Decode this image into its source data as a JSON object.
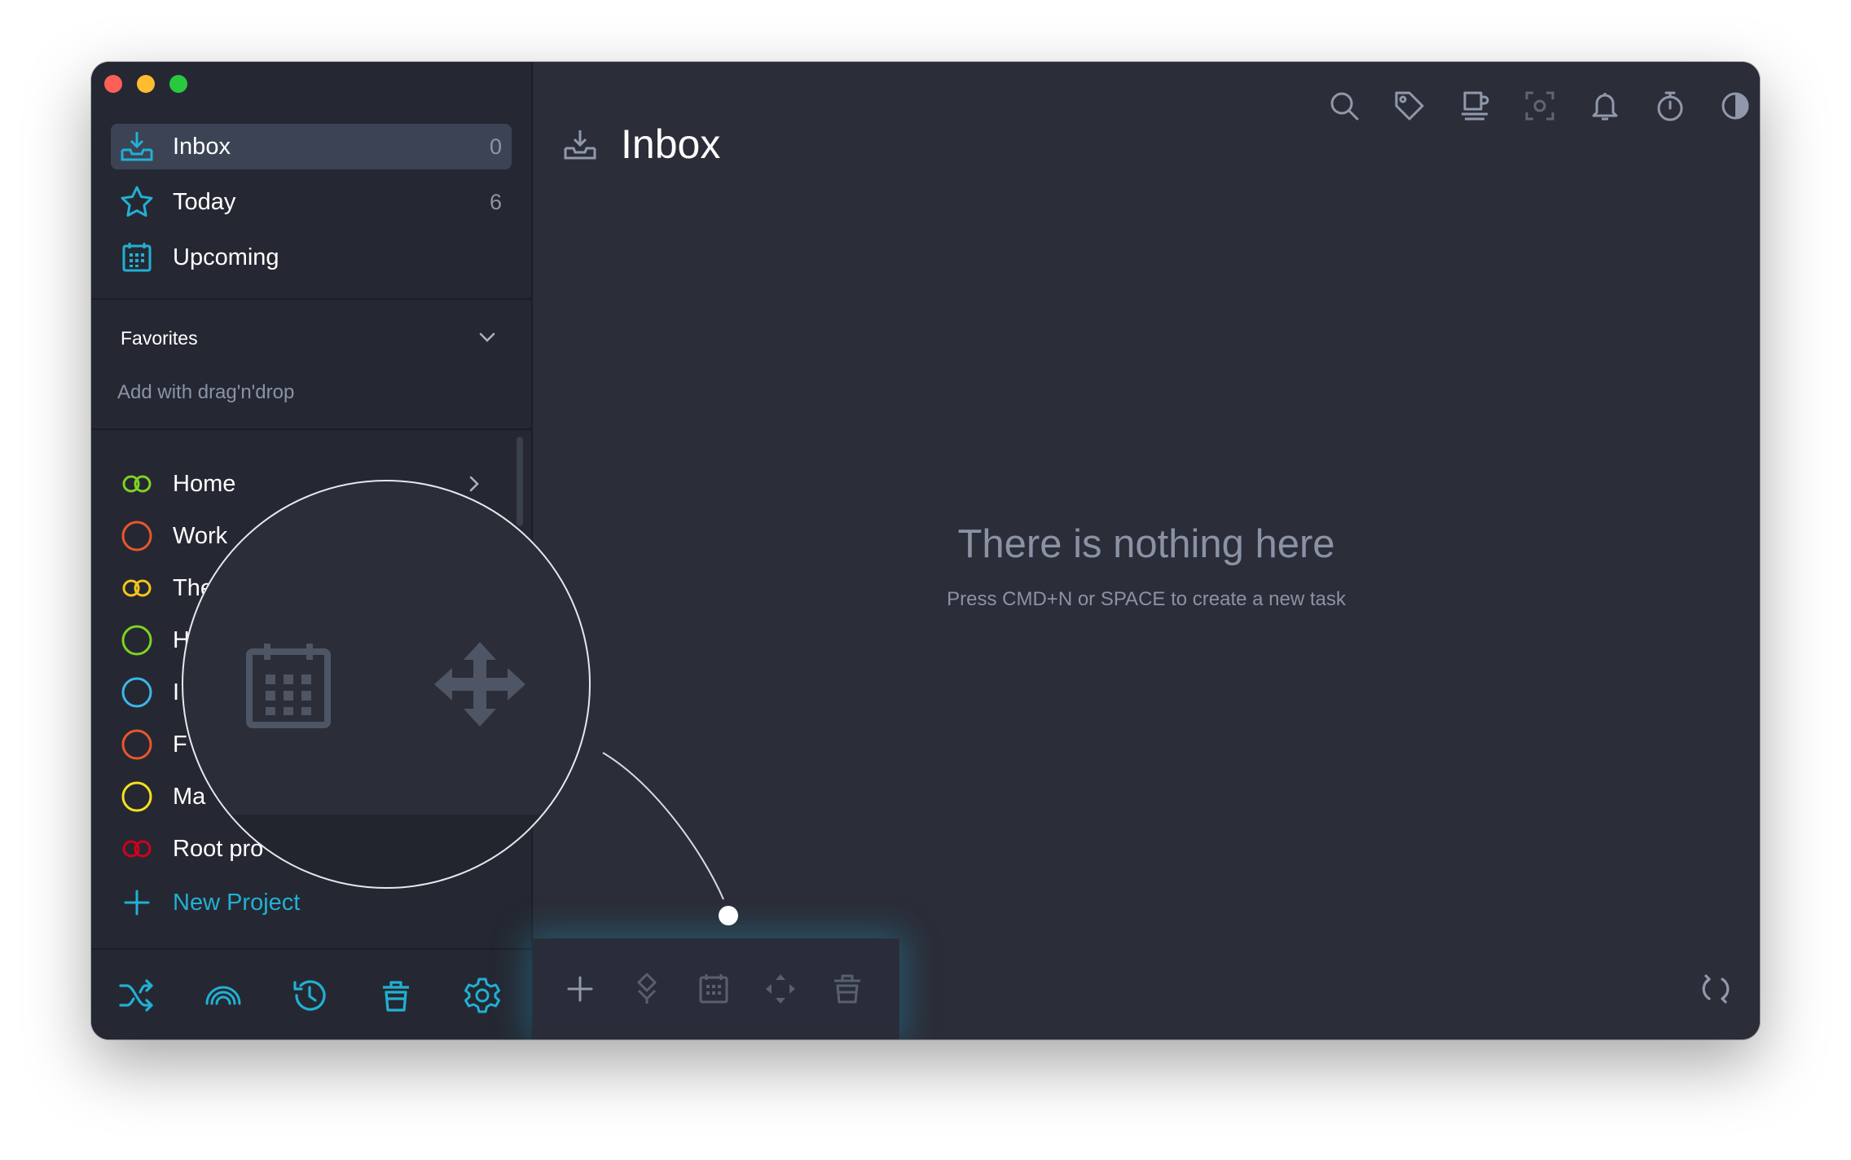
{
  "sidebar": {
    "nav": [
      {
        "label": "Inbox",
        "count": "0",
        "icon": "inbox-icon",
        "active": true
      },
      {
        "label": "Today",
        "count": "6",
        "icon": "star-icon",
        "active": false
      },
      {
        "label": "Upcoming",
        "count": "",
        "icon": "calendar-icon",
        "active": false
      }
    ],
    "favorites": {
      "title": "Favorites",
      "hint": "Add with drag'n'drop"
    },
    "projects": [
      {
        "label": "Home",
        "color": "#7ed321",
        "icon": "project-ring-icon"
      },
      {
        "label": "Work",
        "color": "#e8572c",
        "icon": "project-circle-icon"
      },
      {
        "label": "The",
        "color": "#f5c518",
        "icon": "project-ring-icon"
      },
      {
        "label": "H",
        "color": "#7ed321",
        "icon": "project-circle-icon"
      },
      {
        "label": "I",
        "color": "#3db7e8",
        "icon": "project-circle-icon"
      },
      {
        "label": "F",
        "color": "#e8572c",
        "icon": "project-circle-icon"
      },
      {
        "label": "Ma",
        "color": "#f5e11f",
        "icon": "project-circle-icon"
      },
      {
        "label": "Root pro",
        "color": "#d0021b",
        "icon": "project-ring-icon"
      }
    ],
    "new_project": "New Project",
    "bottom_icons": [
      "shuffle-icon",
      "rainbow-icon",
      "history-icon",
      "trash-icon",
      "settings-icon"
    ]
  },
  "main": {
    "title": "Inbox",
    "empty_title": "There is nothing here",
    "empty_subtitle": "Press CMD+N or SPACE to create a new task",
    "toolbar_icons": [
      "search-icon",
      "tag-icon",
      "coffee-icon",
      "focus-icon",
      "bell-icon",
      "timer-icon",
      "contrast-icon",
      "windows-icon"
    ],
    "action_icons": [
      "add-icon",
      "priority-icon",
      "calendar-icon",
      "move-icon",
      "trash-icon"
    ]
  },
  "colors": {
    "accent": "#21b0d4",
    "background": "#2b2d38",
    "sidebar": "#252832"
  }
}
